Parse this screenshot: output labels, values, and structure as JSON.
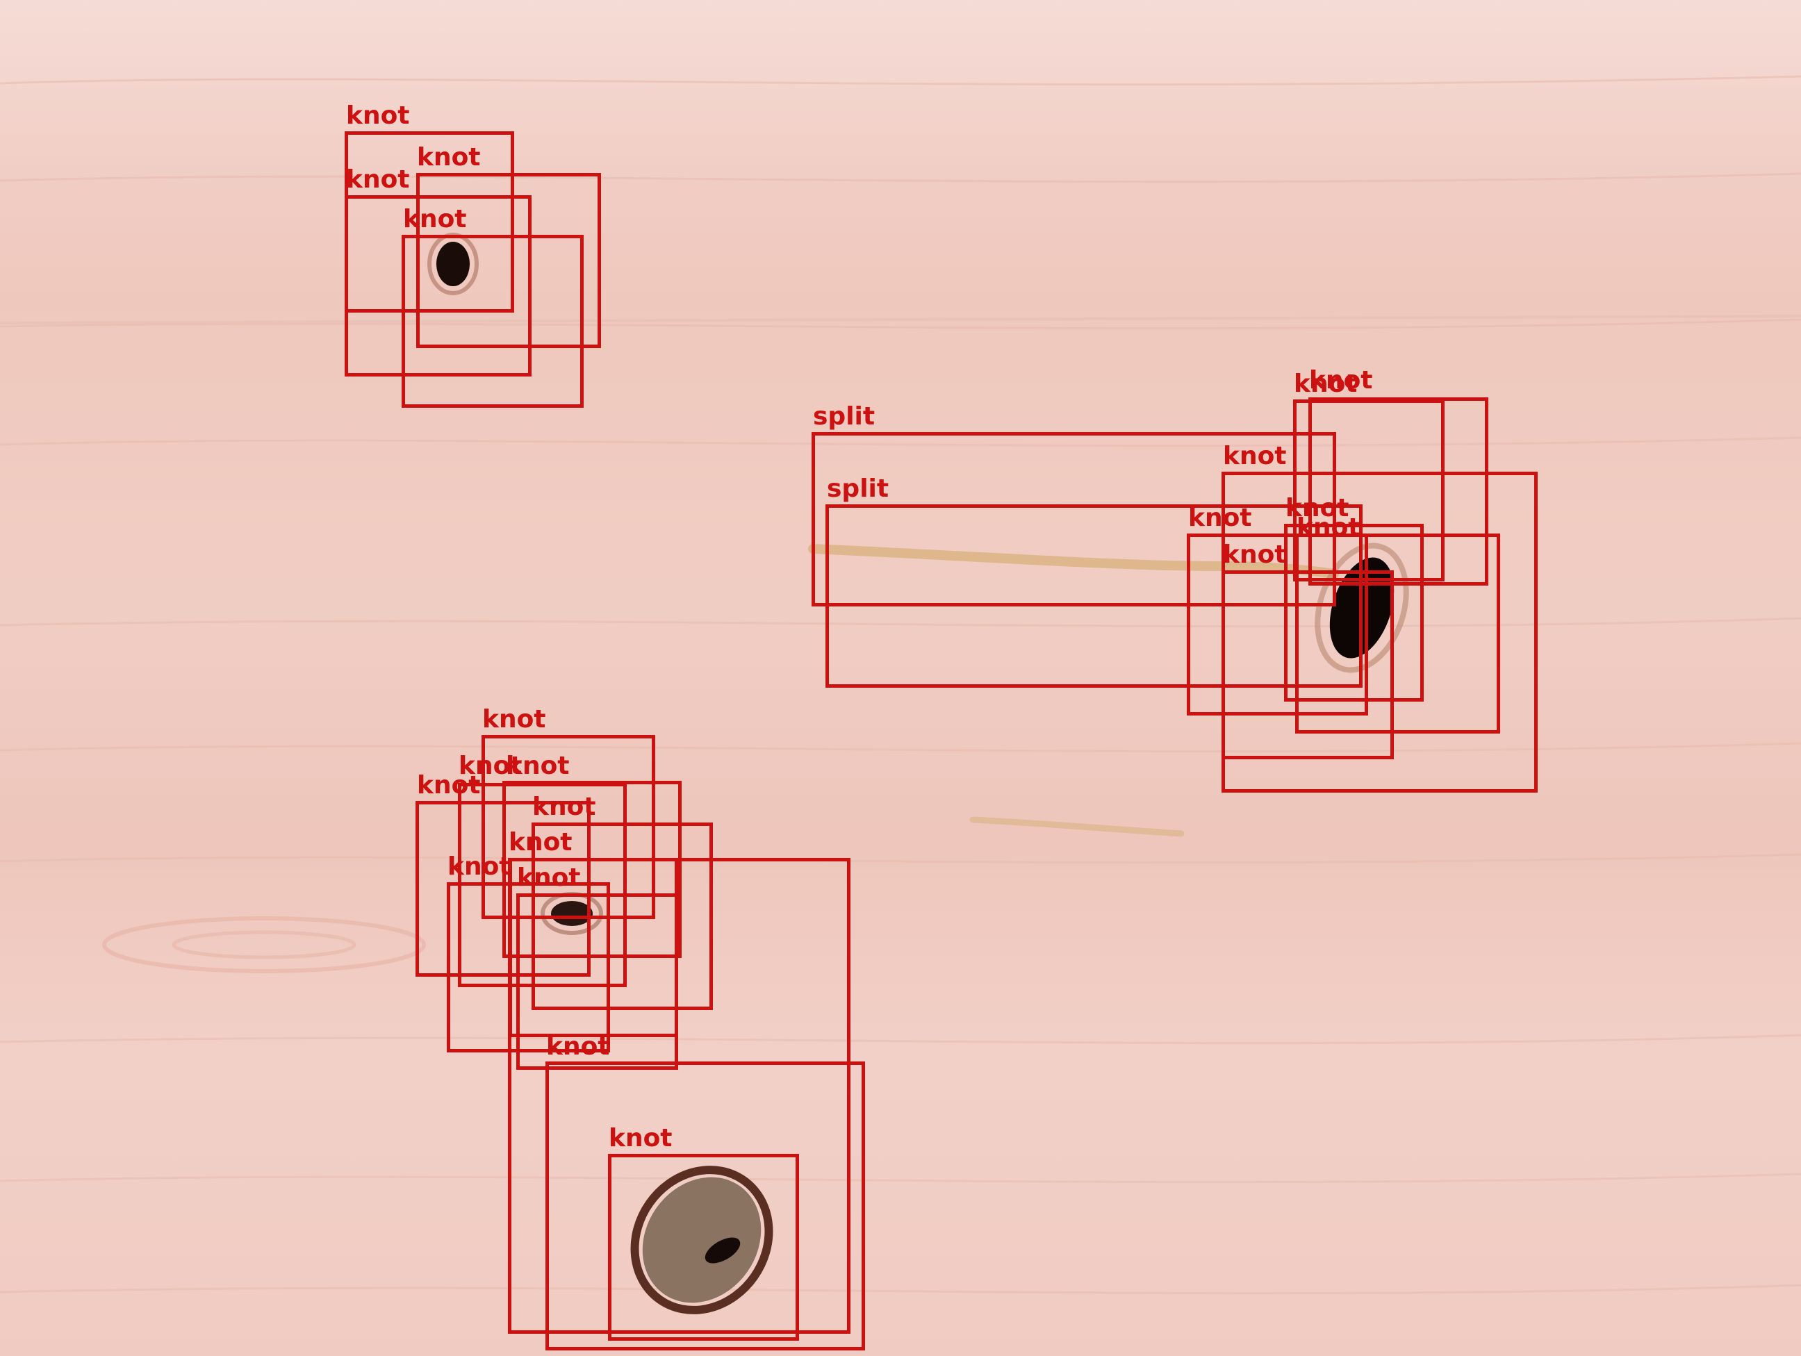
{
  "image": {
    "subject": "wood-board-defects",
    "box_color": "#cc1111"
  },
  "detections": [
    {
      "label": "knot"
    },
    {
      "label": "knot"
    },
    {
      "label": "knot"
    },
    {
      "label": "knot"
    },
    {
      "label": "split"
    },
    {
      "label": "split"
    },
    {
      "label": "knot"
    },
    {
      "label": "knot"
    },
    {
      "label": "knot"
    },
    {
      "label": "knot"
    },
    {
      "label": "knot"
    },
    {
      "label": "knot"
    },
    {
      "label": "knot"
    },
    {
      "label": "knot"
    },
    {
      "label": "knot"
    },
    {
      "label": "knot"
    },
    {
      "label": "knot"
    },
    {
      "label": "knot"
    },
    {
      "label": "knot"
    },
    {
      "label": "knot"
    },
    {
      "label": "knot"
    },
    {
      "label": "knot"
    },
    {
      "label": "knot"
    }
  ]
}
